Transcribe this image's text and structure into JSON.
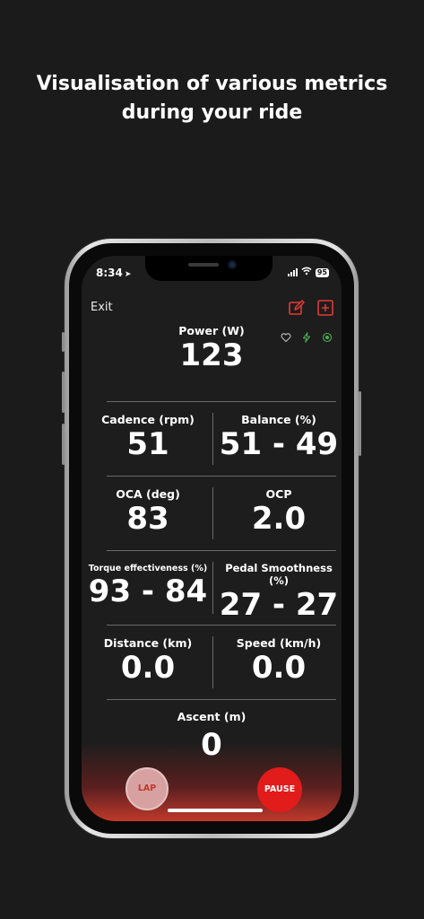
{
  "headline": {
    "line1": "Visualisation of various metrics",
    "line2": "during your ride"
  },
  "status_bar": {
    "time": "8:34",
    "battery": "95"
  },
  "top_bar": {
    "exit_label": "Exit"
  },
  "power": {
    "label": "Power (W)",
    "value": "123"
  },
  "metrics": [
    {
      "label": "Cadence (rpm)",
      "value": "51"
    },
    {
      "label": "Balance (%)",
      "value": "51 - 49"
    },
    {
      "label": "OCA (deg)",
      "value": "83"
    },
    {
      "label": "OCP",
      "value": "2.0"
    },
    {
      "label": "Torque effectiveness (%)",
      "value": "93 - 84"
    },
    {
      "label": "Pedal Smoothness (%)",
      "value": "27 - 27"
    },
    {
      "label": "Distance (km)",
      "value": "0.0"
    },
    {
      "label": "Speed (km/h)",
      "value": "0.0"
    }
  ],
  "ascent": {
    "label": "Ascent (m)",
    "value": "0"
  },
  "buttons": {
    "lap_label": "LAP",
    "pause_label": "PAUSE"
  },
  "colors": {
    "accent_red": "#e21b1b",
    "sensor_green": "#4caf50",
    "background": "#1d1d1d"
  }
}
